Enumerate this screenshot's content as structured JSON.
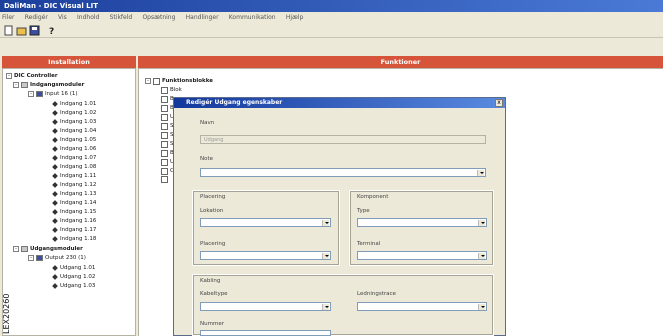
{
  "window": {
    "title": "DaliMan - DIC Visual LIT"
  },
  "menu": [
    "Filer",
    "Redigér",
    "Vis",
    "Indhold",
    "Stikfeld",
    "Opsætning",
    "Handlinger",
    "Kommunikation",
    "Hjælp"
  ],
  "panels": {
    "left_title": "Installation",
    "right_title": "Funktioner"
  },
  "tree": {
    "root": "DIC Controller",
    "group1": "Indgangsmoduler",
    "module1": "Input 16 (1)",
    "inputs": [
      "Indgang 1.01",
      "Indgang 1.02",
      "Indgang 1.03",
      "Indgang 1.04",
      "Indgang 1.05",
      "Indgang 1.06",
      "Indgang 1.07",
      "Indgang 1.08",
      "Indgang 1.11",
      "Indgang 1.12",
      "Indgang 1.13",
      "Indgang 1.14",
      "Indgang 1.15",
      "Indgang 1.16",
      "Indgang 1.17",
      "Indgang 1.18"
    ],
    "group2": "Udgangsmoduler",
    "module2": "Output 230 (1)",
    "outputs": [
      "Udgang 1.01",
      "Udgang 1.02",
      "Udgang 1.03"
    ]
  },
  "functions": {
    "root": "Funktionsblokke",
    "first": "Blok",
    "stub_letters": [
      "B",
      "B",
      "U",
      "S",
      "S",
      "S",
      "B",
      "U",
      "C"
    ]
  },
  "dialog": {
    "title": "Redigér Udgang egenskaber",
    "close": "x",
    "navn_label": "Navn",
    "navn_value": "Udgang",
    "note_label": "Note",
    "placering_group": "Placering",
    "lokation_label": "Lokation",
    "placering_label": "Placering",
    "komponent_group": "Komponent",
    "type_label": "Type",
    "terminal_label": "Terminal",
    "kabling_group": "Kabling",
    "kabeltype_label": "Kabeltype",
    "ledningstrace_label": "Lednings­trace",
    "nummer_label": "Nummer"
  },
  "side_code": "LEX20260",
  "colors": {
    "panel_header": "#d6543a",
    "title_gradient_start": "#1c3f9c",
    "window_bg": "#ece9d8"
  }
}
